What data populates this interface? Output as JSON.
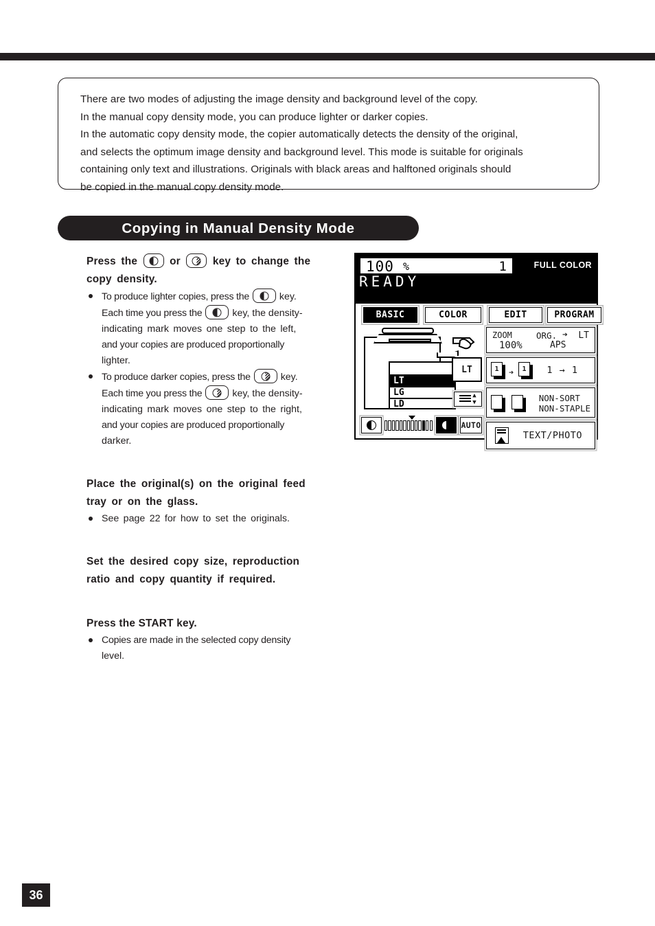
{
  "intro": {
    "lines": [
      "There are two modes of adjusting the image density and background level of the copy.",
      "In the manual copy density mode, you can produce lighter or darker copies.",
      "In the automatic copy density mode, the copier automatically detects the density of the original,",
      "and selects the optimum image density and background level. This mode is suitable for originals",
      "containing only text and illustrations. Originals with black areas and halftoned originals should",
      "be copied in the manual copy density mode."
    ]
  },
  "section": {
    "title": "Copying in Manual Density Mode"
  },
  "steps": {
    "step1": {
      "head_a": "Press the",
      "head_or": "or",
      "head_b": "key to change the",
      "head_c": "copy density.",
      "bullets": [
        {
          "a": "To produce lighter copies, press the",
          "b": "key.",
          "c": "Each time you press the",
          "d": "key, the density-",
          "e": "indicating mark moves one step to the left,",
          "f": "and your copies are produced proportionally",
          "g": "lighter."
        },
        {
          "a": "To produce darker copies, press the",
          "b": "key.",
          "c": "Each time you press the",
          "d": "key, the density-",
          "e": "indicating mark moves one step to the right,",
          "f": "and your copies are produced proportionally",
          "g": "darker."
        }
      ]
    },
    "step2": {
      "head_a": "Place the original(s) on the original feed",
      "head_b": "tray or on the glass.",
      "bullet": "See page 22 for how to set the originals."
    },
    "step3": {
      "head_a": "Set the desired copy size, reproduction",
      "head_b": "ratio and copy quantity if required."
    },
    "step4": {
      "head_a": "Press the START key.",
      "bullet_a": "Copies are made in the selected copy density",
      "bullet_b": "level."
    }
  },
  "lcd": {
    "zoom_value": "100",
    "percent_symbol": "%",
    "copy_quantity": "1",
    "color_mode": "FULL COLOR",
    "status": "READY",
    "tabs": [
      {
        "label": "BASIC",
        "selected": true
      },
      {
        "label": "COLOR",
        "selected": false
      },
      {
        "label": "EDIT",
        "selected": false
      },
      {
        "label": "PROGRAM",
        "selected": false
      }
    ],
    "cassettes": [
      {
        "label": "",
        "selected": false
      },
      {
        "label": "LT",
        "selected": true
      },
      {
        "label": "LG",
        "selected": false
      },
      {
        "label": "LD",
        "selected": false
      }
    ],
    "bypass_label": "LT",
    "density": {
      "lighter_key": "lighter-key",
      "darker_key": "darker-key",
      "auto_label": "AUTO",
      "segments": 13,
      "marker_index": 6,
      "filled_index": 10
    },
    "functions": {
      "zoom_label": "ZOOM",
      "zoom_value": "100%",
      "org_label": "ORG.",
      "org_arrow": "➔",
      "paper_label": "LT",
      "aps_label": "APS",
      "duplex_label": "1 → 1",
      "duplex_from": "1",
      "duplex_to": "1",
      "duplex_arrow": "➔",
      "finish_line1": "NON-SORT",
      "finish_line2": "NON-STAPLE",
      "original_mode": "TEXT/PHOTO"
    }
  },
  "footer": {
    "page_number": "36"
  }
}
